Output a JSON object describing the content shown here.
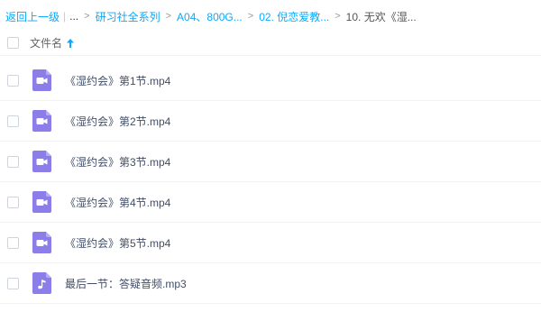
{
  "breadcrumb": {
    "back": "返回上一级",
    "ellipsis": "...",
    "items": [
      "研习社全系列",
      "A04、800G...",
      "02. 倪恋爱教..."
    ],
    "current": "10. 无欢《湿..."
  },
  "header": {
    "name_col": "文件名",
    "sort": "ascending"
  },
  "files": [
    {
      "name": "《湿约会》第1节.mp4",
      "type": "video"
    },
    {
      "name": "《湿约会》第2节.mp4",
      "type": "video"
    },
    {
      "name": "《湿约会》第3节.mp4",
      "type": "video"
    },
    {
      "name": "《湿约会》第4节.mp4",
      "type": "video"
    },
    {
      "name": "《湿约会》第5节.mp4",
      "type": "video"
    },
    {
      "name": "最后一节：答疑音频.mp3",
      "type": "audio"
    }
  ],
  "colors": {
    "link": "#09aaff",
    "video_icon": "#8c7ee8",
    "audio_icon": "#8c7ee8"
  }
}
